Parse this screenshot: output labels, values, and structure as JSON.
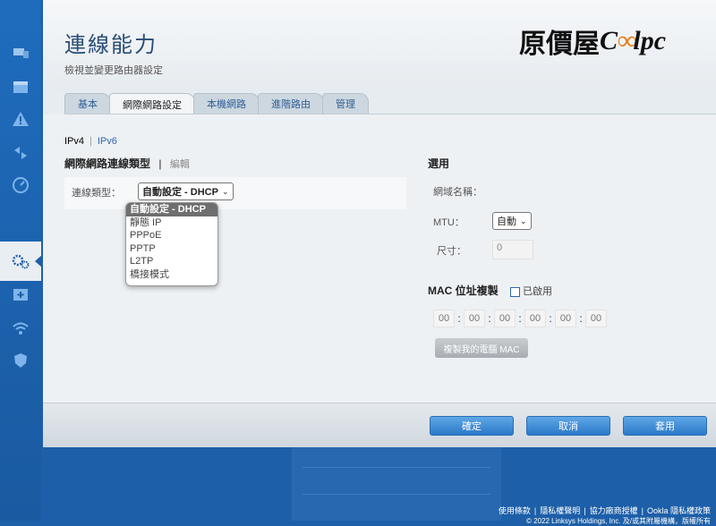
{
  "header": {
    "title": "連線能力",
    "subtitle": "檢視並變更路由器設定",
    "logo_text": "原價屋Coolpc"
  },
  "tabs": [
    {
      "label": "基本",
      "active": false
    },
    {
      "label": "網際網路設定",
      "active": true
    },
    {
      "label": "本機網路",
      "active": false
    },
    {
      "label": "進階路由",
      "active": false
    },
    {
      "label": "管理",
      "active": false
    }
  ],
  "ip_tabs": {
    "ipv4": "IPv4",
    "ipv6": "IPv6"
  },
  "connection": {
    "section_title": "網際網路連線類型",
    "edit_label": "編輯",
    "type_label": "連線類型：",
    "selected_value": "自動設定 - DHCP",
    "options": [
      "自動設定 - DHCP",
      "靜態 IP",
      "PPPoE",
      "PPTP",
      "L2TP",
      "橋接模式"
    ]
  },
  "optional": {
    "section_title": "選用",
    "domain_label": "網域名稱：",
    "mtu_label": "MTU：",
    "mtu_value": "自動",
    "size_label": "尺寸：",
    "size_value": "0"
  },
  "mac": {
    "section_title": "MAC 位址複製",
    "enabled_label": "已啟用",
    "segments": [
      "00",
      "00",
      "00",
      "00",
      "00",
      "00"
    ],
    "clone_button": "複製我的電腦 MAC"
  },
  "footer": {
    "ok_button": "確定",
    "cancel_button": "取消",
    "apply_button": "套用"
  },
  "bottom_links": [
    "使用條款",
    "隱私權聲明",
    "協力廠商授權",
    "Ookla 隱私權政策"
  ],
  "copyright": "© 2022 Linksys Holdings, Inc. 及/或其附屬機構，版權所有",
  "colors": {
    "accent": "#1d5fa8",
    "button": "#2b79c8",
    "logo_orange": "#e87a10"
  }
}
